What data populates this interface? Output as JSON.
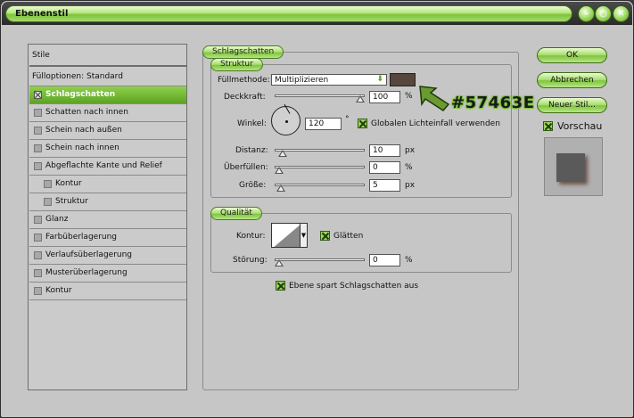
{
  "title": "Ebenenstil",
  "title_buttons": [
    "minimize",
    "maximize",
    "close"
  ],
  "left_panel": {
    "header": "Stile",
    "items": [
      {
        "label": "Fülloptionen: Standard",
        "checkbox": false,
        "checked": false,
        "selected": false,
        "indent": 0
      },
      {
        "label": "Schlagschatten",
        "checkbox": true,
        "checked": true,
        "selected": true,
        "indent": 0
      },
      {
        "label": "Schatten nach innen",
        "checkbox": true,
        "checked": false,
        "selected": false,
        "indent": 0
      },
      {
        "label": "Schein nach außen",
        "checkbox": true,
        "checked": false,
        "selected": false,
        "indent": 0
      },
      {
        "label": "Schein nach innen",
        "checkbox": true,
        "checked": false,
        "selected": false,
        "indent": 0
      },
      {
        "label": "Abgeflachte Kante und Relief",
        "checkbox": true,
        "checked": false,
        "selected": false,
        "indent": 0
      },
      {
        "label": "Kontur",
        "checkbox": true,
        "checked": false,
        "selected": false,
        "indent": 1
      },
      {
        "label": "Struktur",
        "checkbox": true,
        "checked": false,
        "selected": false,
        "indent": 1
      },
      {
        "label": "Glanz",
        "checkbox": true,
        "checked": false,
        "selected": false,
        "indent": 0
      },
      {
        "label": "Farbüberlagerung",
        "checkbox": true,
        "checked": false,
        "selected": false,
        "indent": 0
      },
      {
        "label": "Verlaufsüberlagerung",
        "checkbox": true,
        "checked": false,
        "selected": false,
        "indent": 0
      },
      {
        "label": "Musterüberlagerung",
        "checkbox": true,
        "checked": false,
        "selected": false,
        "indent": 0
      },
      {
        "label": "Kontur",
        "checkbox": true,
        "checked": false,
        "selected": false,
        "indent": 0
      }
    ]
  },
  "main": {
    "section_title": "Schlagschatten",
    "struktur": {
      "title": "Struktur",
      "fuellmethode_label": "Füllmethode:",
      "fuellmethode_value": "Multiplizieren",
      "color": "#57463E",
      "deckkraft_label": "Deckkraft:",
      "deckkraft_value": "100",
      "deckkraft_unit": "%",
      "deckkraft_level": 1.0,
      "winkel_label": "Winkel:",
      "winkel_value": "120",
      "winkel_unit": "°",
      "global_light_label": "Globalen Lichteinfall verwenden",
      "global_light_checked": true,
      "distanz_label": "Distanz:",
      "distanz_value": "10",
      "distanz_unit": "px",
      "distanz_level": 0.04,
      "ueberfuellen_label": "Überfüllen:",
      "ueberfuellen_value": "0",
      "ueberfuellen_unit": "%",
      "ueberfuellen_level": 0.0,
      "groesse_label": "Größe:",
      "groesse_value": "5",
      "groesse_unit": "px",
      "groesse_level": 0.02
    },
    "qualitaet": {
      "title": "Qualität",
      "kontur_label": "Kontur:",
      "glaetten_label": "Glätten",
      "glaetten_checked": true,
      "stoerung_label": "Störung:",
      "stoerung_value": "0",
      "stoerung_unit": "%",
      "stoerung_level": 0.0
    },
    "knockout_label": "Ebene spart Schlagschatten aus",
    "knockout_checked": true,
    "annotation": "#57463E",
    "annotation_color": "#57463E"
  },
  "buttons": {
    "ok": "OK",
    "cancel": "Abbrechen",
    "new_style": "Neuer Stil...",
    "preview_label": "Vorschau",
    "preview_checked": true
  },
  "colors": {
    "accent_green": "#7ec43d",
    "dialog_bg": "#c6c6c6",
    "shadow_color": "#57463E"
  }
}
